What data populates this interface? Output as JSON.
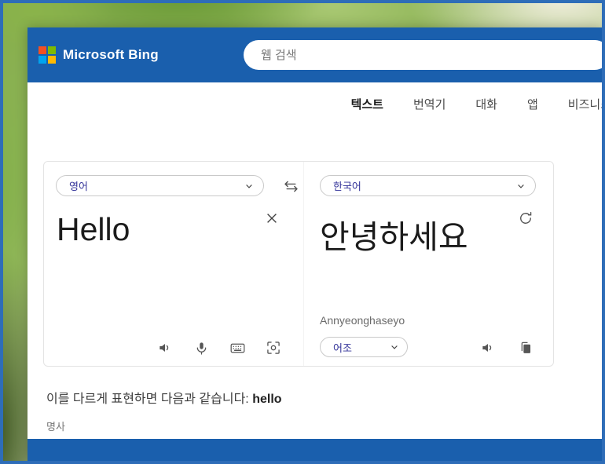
{
  "header": {
    "brand": "Microsoft Bing",
    "search_placeholder": "웹 검색"
  },
  "nav": {
    "tabs": [
      {
        "label": "텍스트",
        "active": true
      },
      {
        "label": "번역기",
        "active": false
      },
      {
        "label": "대화",
        "active": false
      },
      {
        "label": "앱",
        "active": false
      },
      {
        "label": "비즈니스",
        "active": false
      }
    ]
  },
  "translator": {
    "source": {
      "language": "영어",
      "text": "Hello"
    },
    "target": {
      "language": "한국어",
      "text": "안녕하세요",
      "romanization": "Annyeonghaseyo",
      "tone_label": "어조"
    }
  },
  "alternatives": {
    "intro": "이를 다르게 표현하면 다음과 같습니다: ",
    "word": "hello",
    "part_of_speech": "명사"
  },
  "icons": {
    "microsoft-logo": "four-color-squares",
    "chevron-down": "▾",
    "swap-languages": "⇄",
    "clear-text": "✕",
    "refresh-translation": "⟳",
    "speaker": "volume",
    "microphone": "mic",
    "keyboard": "keyboard",
    "image-translate": "scan-frame-with-circle",
    "copy": "copy-sheet"
  },
  "colors": {
    "header_blue": "#1a5fad",
    "border_blue": "#2e6db8",
    "logo_red": "#f25022",
    "logo_green": "#7fba00",
    "logo_blue": "#00a4ef",
    "logo_yellow": "#ffb900",
    "lang_text": "#333399",
    "icon_gray": "#565656"
  }
}
